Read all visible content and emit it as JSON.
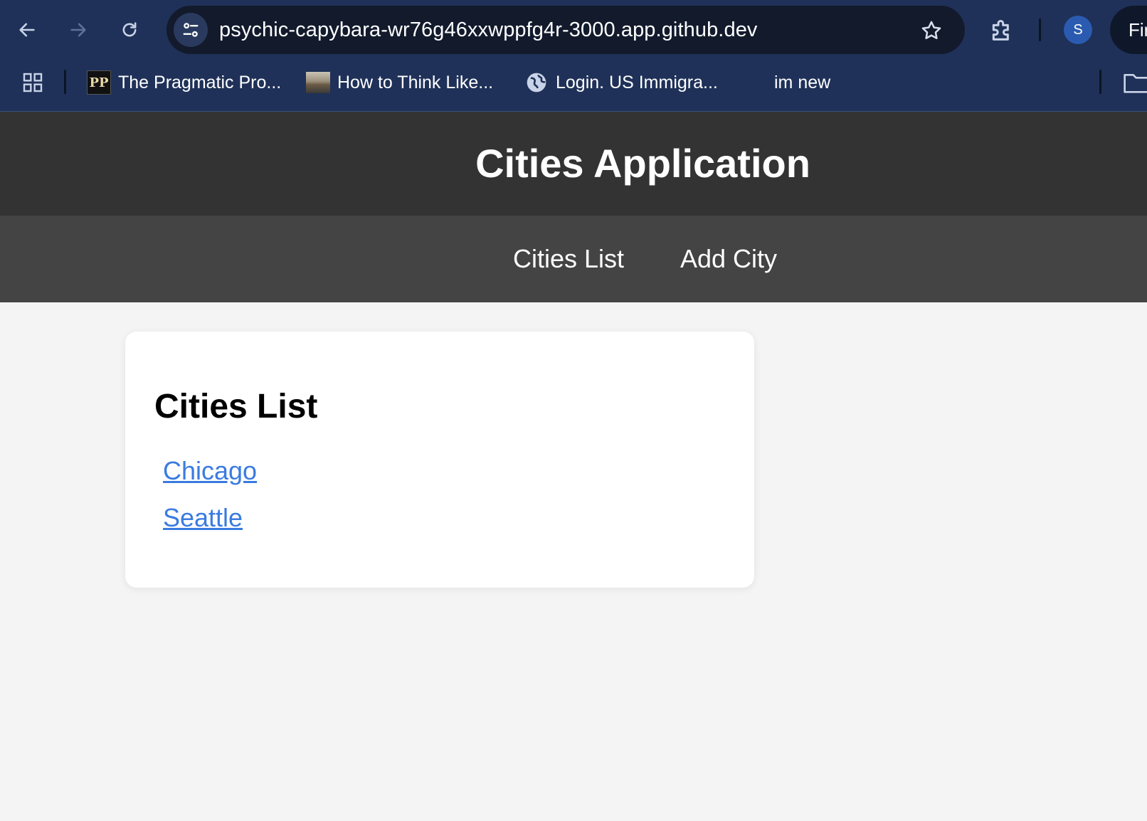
{
  "browser": {
    "url": "psychic-capybara-wr76g46xxwppfg4r-3000.app.github.dev",
    "profile_initial": "S",
    "find_label": "Fir",
    "icons": {
      "back": "arrow-left-icon",
      "forward": "arrow-right-icon",
      "reload": "reload-icon",
      "site_info": "tune-icon",
      "bookmark": "star-icon",
      "extensions": "puzzle-icon",
      "apps": "apps-grid-icon",
      "folder": "folder-icon"
    },
    "bookmarks": [
      {
        "label": "The Pragmatic Pro...",
        "icon": "pragmatic-programmer-icon",
        "icon_text": "PP"
      },
      {
        "label": "How to Think Like...",
        "icon": "photo-thumbnail-icon"
      },
      {
        "label": "Login. US Immigra...",
        "icon": "globe-icon"
      },
      {
        "label": "im new",
        "icon": "microsoft-logo-icon"
      }
    ],
    "colors": {
      "chrome_bg": "#1f3158",
      "omnibox_bg": "#121a2c"
    }
  },
  "app": {
    "title": "Cities Application",
    "nav": [
      {
        "label": "Cities List"
      },
      {
        "label": "Add City"
      }
    ],
    "card": {
      "title": "Cities List",
      "cities": [
        "Chicago",
        "Seattle"
      ]
    },
    "colors": {
      "header_bg": "#333333",
      "nav_bg": "#444444",
      "page_bg": "#f4f4f4",
      "link": "#3a7be0"
    }
  }
}
